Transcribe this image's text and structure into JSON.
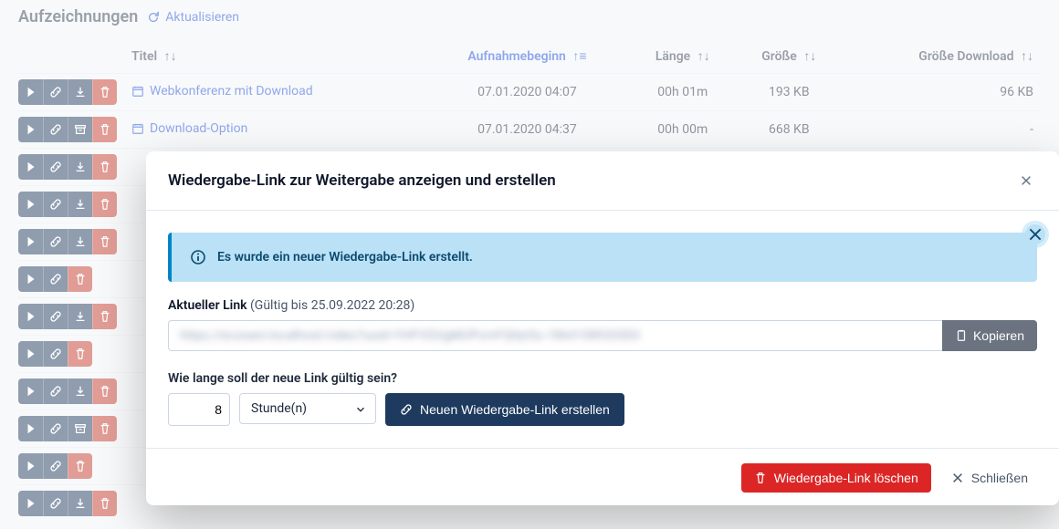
{
  "section": {
    "title": "Aufzeichnungen",
    "refresh_label": "Aktualisieren"
  },
  "table": {
    "headers": {
      "title": "Titel",
      "start": "Aufnahmebeginn",
      "length": "Länge",
      "size": "Größe",
      "download_size": "Größe Download"
    },
    "rows": [
      {
        "title": "Webkonferenz mit Download",
        "start": "07.01.2020 04:07",
        "length": "00h 01m",
        "size": "193 KB",
        "download_size": "96 KB",
        "action3": "download"
      },
      {
        "title": "Download-Option",
        "start": "07.01.2020 04:37",
        "length": "00h 00m",
        "size": "668 KB",
        "download_size": "-",
        "action3": "archive"
      }
    ],
    "extra_rows": [
      {
        "action3": "download"
      },
      {
        "action3": "download"
      },
      {
        "action3": "download"
      },
      {
        "action3": "none"
      },
      {
        "action3": "download"
      },
      {
        "action3": "none"
      },
      {
        "action3": "download"
      },
      {
        "action3": "archive"
      },
      {
        "action3": "none"
      },
      {
        "action3": "download"
      }
    ]
  },
  "modal": {
    "title": "Wiedergabe-Link zur Weitergabe anzeigen und erstellen",
    "alert": "Es wurde ein neuer Wiedergabe-Link erstellt.",
    "current_link_label": "Aktueller Link",
    "current_link_sub": "(Gültig bis 25.09.2022 20:28)",
    "link_value": "https://ecosani.localhost/video?uuid=YHFVQVgMUPcmFQ0yt3u-1864108926503",
    "copy_label": "Kopieren",
    "duration_label": "Wie lange soll der neue Link gültig sein?",
    "duration_value": "8",
    "duration_unit": "Stunde(n)",
    "create_label": "Neuen Wiedergabe-Link erstellen",
    "delete_label": "Wiedergabe-Link löschen",
    "close_label": "Schließen"
  }
}
